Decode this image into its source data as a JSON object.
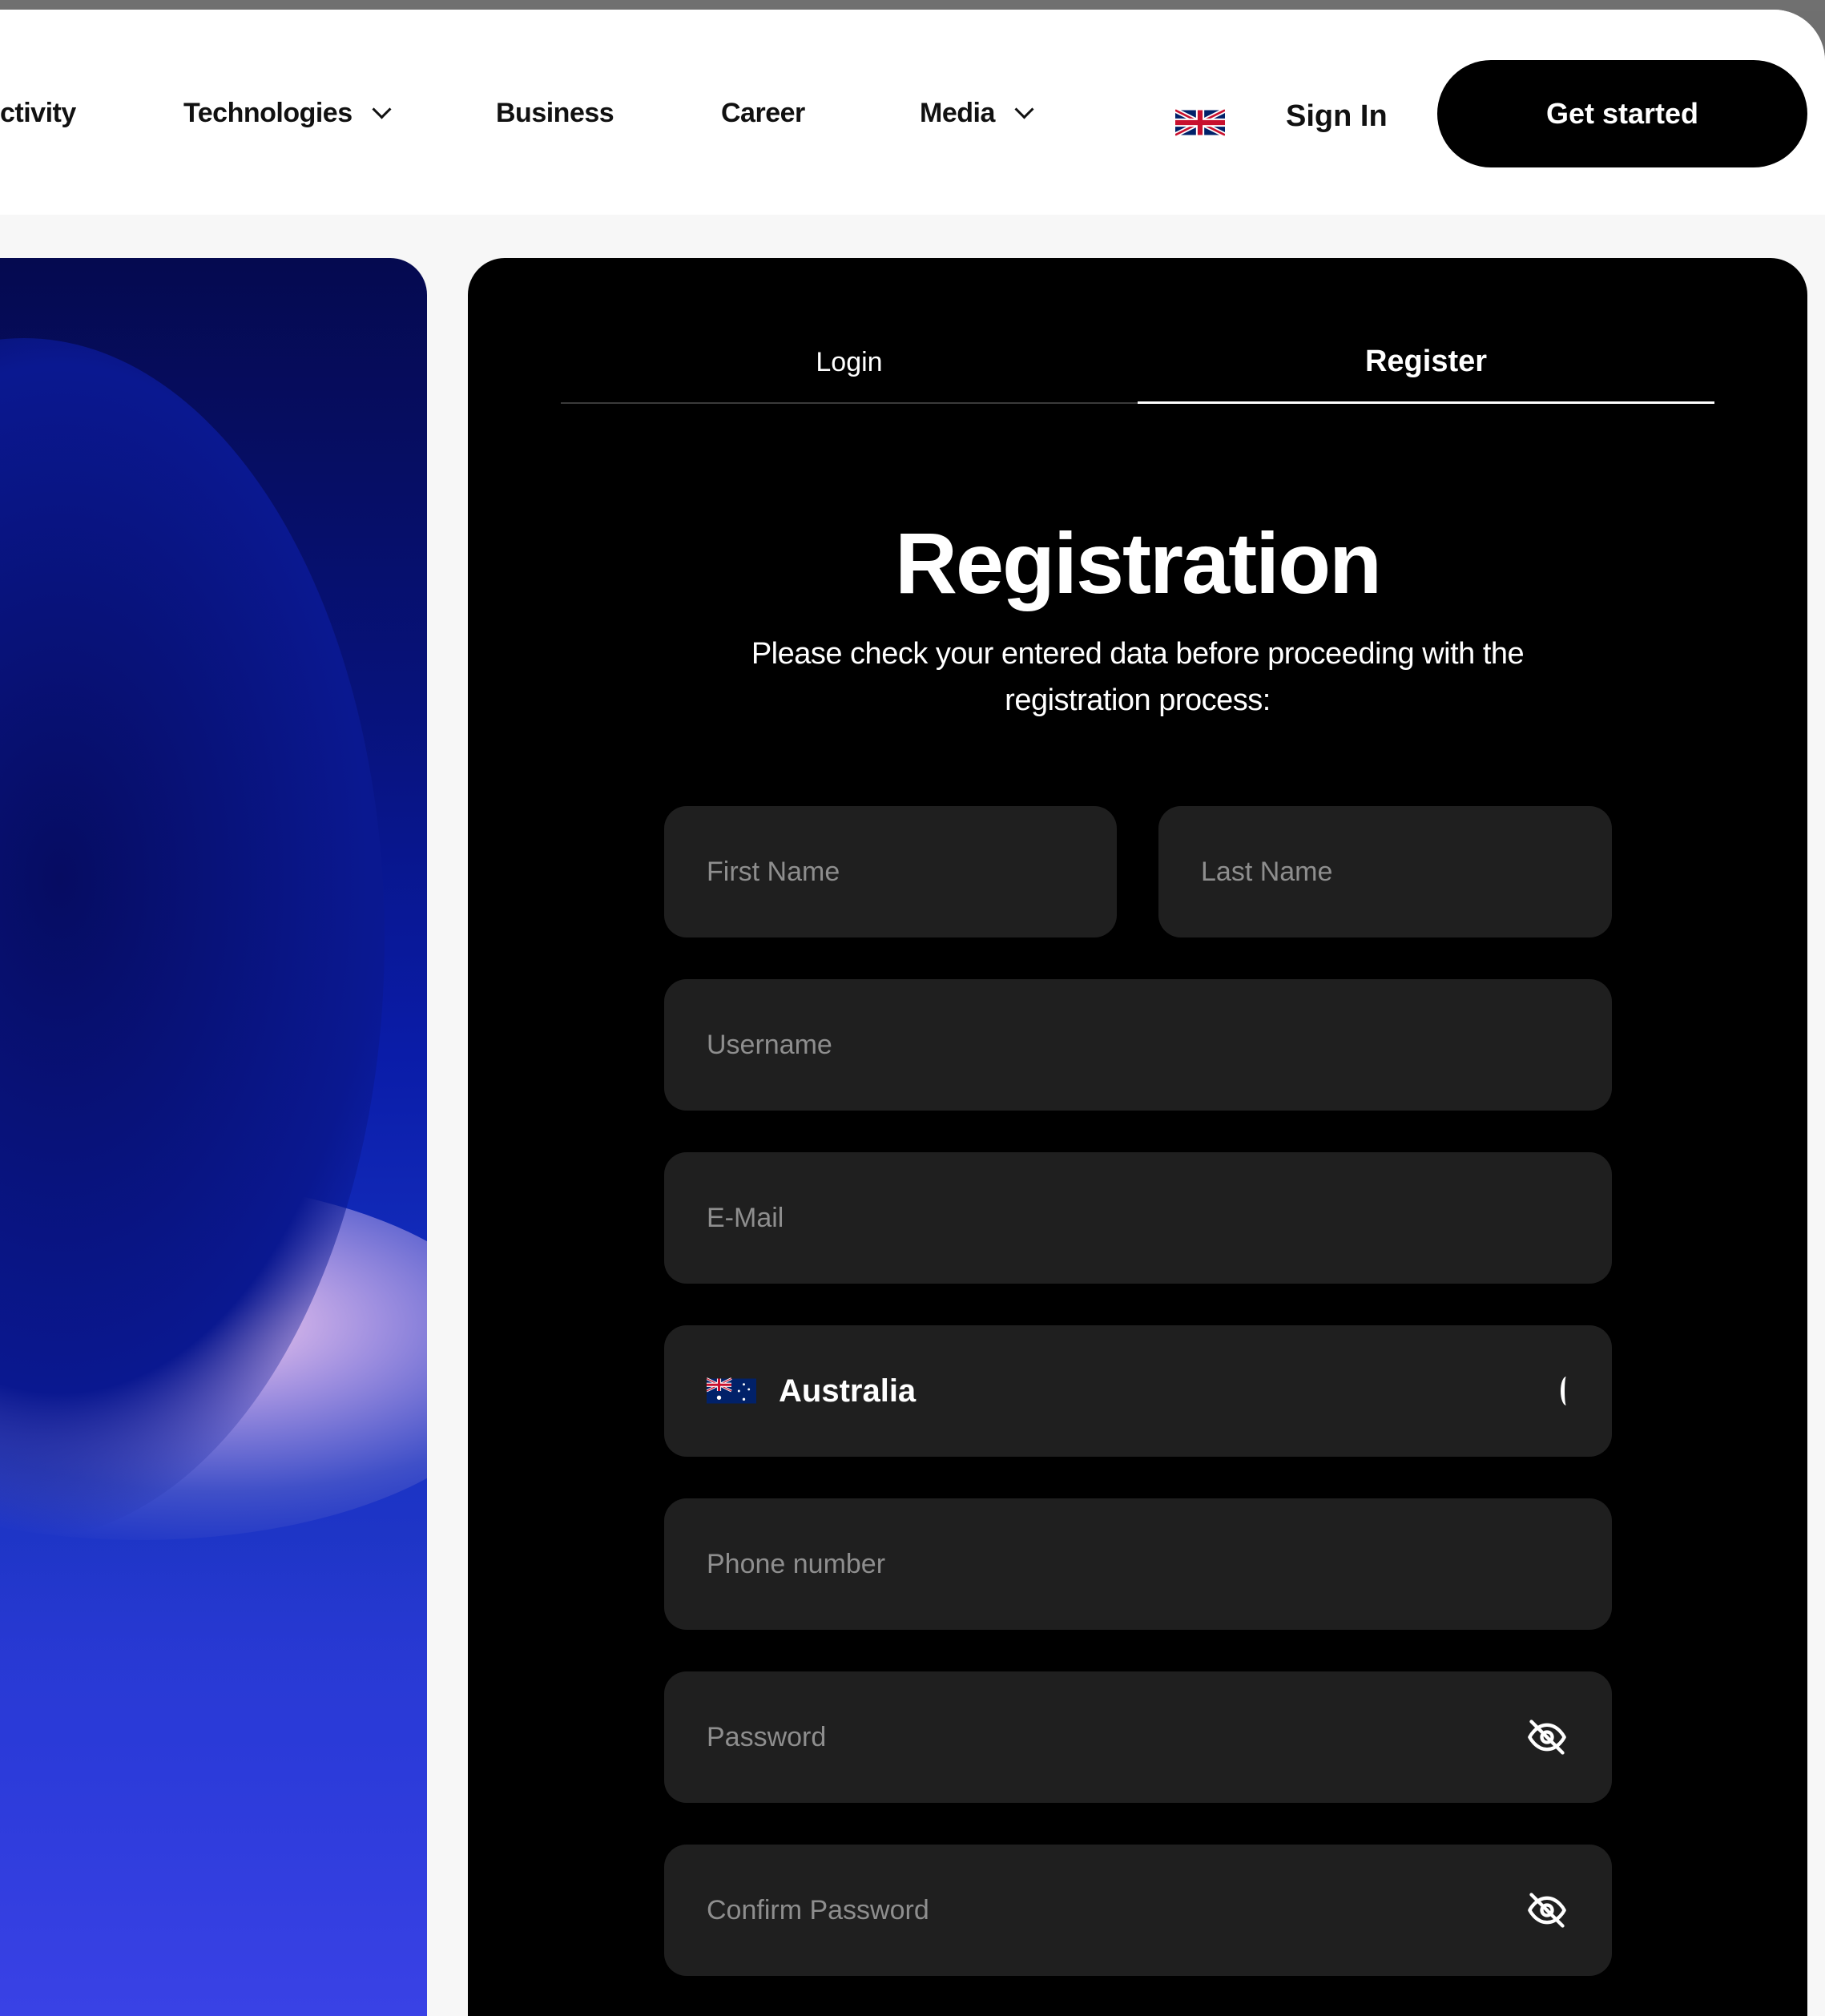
{
  "nav": {
    "items": [
      {
        "label": "ctivity",
        "has_dropdown": false
      },
      {
        "label": "Technologies",
        "has_dropdown": true
      },
      {
        "label": "Business",
        "has_dropdown": false
      },
      {
        "label": "Career",
        "has_dropdown": false
      },
      {
        "label": "Media",
        "has_dropdown": true
      }
    ],
    "language_flag": "uk-flag-icon",
    "sign_in": "Sign In",
    "cta": "Get started"
  },
  "auth": {
    "tabs": [
      {
        "label": "Login",
        "active": false
      },
      {
        "label": "Register",
        "active": true
      }
    ],
    "title": "Registration",
    "subtitle_line1": "Please check your entered data before proceeding with the",
    "subtitle_line2": "registration process:",
    "fields": {
      "first_name": {
        "placeholder": "First Name",
        "value": ""
      },
      "last_name": {
        "placeholder": "Last Name",
        "value": ""
      },
      "username": {
        "placeholder": "Username",
        "value": ""
      },
      "email": {
        "placeholder": "E-Mail",
        "value": ""
      },
      "country": {
        "value": "Australia",
        "icon": "australia-flag-icon"
      },
      "phone": {
        "placeholder": "Phone number",
        "value": ""
      },
      "password": {
        "placeholder": "Password",
        "value": "",
        "icon": "eye-off-icon"
      },
      "confirm_password": {
        "placeholder": "Confirm Password",
        "value": "",
        "icon": "eye-off-icon"
      }
    }
  },
  "colors": {
    "panel_bg": "#000000",
    "field_bg": "#1f1f1f",
    "cta_bg": "#000000",
    "hero_blue": "#0a1ca8"
  }
}
